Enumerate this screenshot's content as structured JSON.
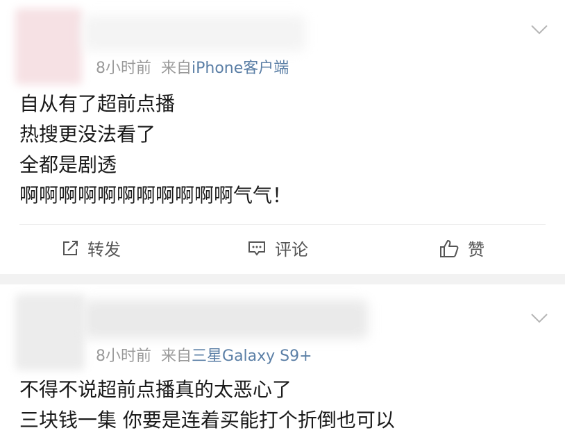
{
  "posts": [
    {
      "meta": {
        "time": "8小时前",
        "from_prefix": "来自",
        "source": "iPhone客户端"
      },
      "lines": [
        "自从有了超前点播",
        "热搜更没法看了",
        "全都是剧透",
        "啊啊啊啊啊啊啊啊啊啊啊气气！"
      ],
      "actions": {
        "repost": "转发",
        "comment": "评论",
        "like": "赞"
      }
    },
    {
      "meta": {
        "time": "8小时前",
        "from_prefix": "来自",
        "source": "三星Galaxy S9+"
      },
      "lines": [
        "不得不说超前点播真的太恶心了",
        "三块钱一集  你要是连着买能打个折倒也可以"
      ]
    }
  ],
  "icons": {
    "more": "chevron-down-icon",
    "repost": "repost-icon",
    "comment": "comment-icon",
    "like": "thumbs-up-icon"
  },
  "colors": {
    "meta_text": "#9a9a9a",
    "source_link": "#5b7fa6",
    "separator": "#f2f2f2"
  }
}
